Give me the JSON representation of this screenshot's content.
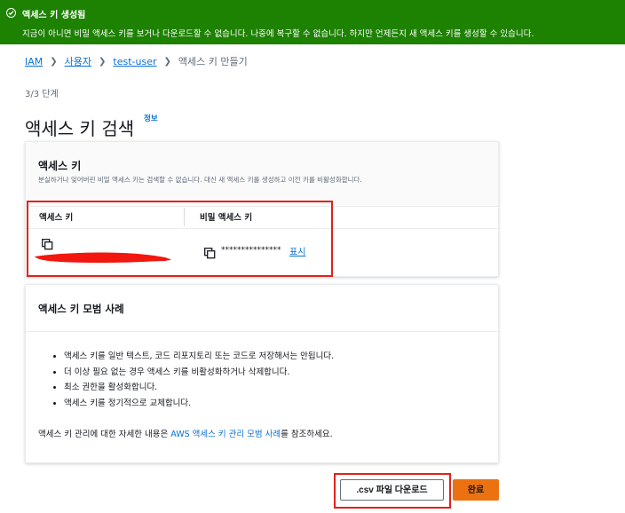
{
  "banner": {
    "title": "액세스 키 생성됨",
    "message": "지금이 아니면 비밀 액세스 키를 보거나 다운로드할 수 없습니다. 나중에 복구할 수 없습니다. 하지만 언제든지 새 액세스 키를 생성할 수 있습니다.",
    "color": "#1d8102"
  },
  "breadcrumb": {
    "items": [
      "IAM",
      "사용자",
      "test-user"
    ],
    "current": "액세스 키 만들기"
  },
  "step": "3/3 단계",
  "page_title": "액세스 키 검색",
  "info_label": "정보",
  "access_key_panel": {
    "title": "액세스 키",
    "description": "분실하거나 잊어버린 비밀 액세스 키는 검색할 수 없습니다. 대신 새 액세스 키를 생성하고 이전 키를 비활성화합니다.",
    "columns": [
      "액세스 키",
      "비밀 액세스 키"
    ],
    "secret_masked": "***************",
    "show_label": "표시"
  },
  "best_practices": {
    "title": "액세스 키 모범 사례",
    "items": [
      "액세스 키를 일반 텍스트, 코드 리포지토리 또는 코드로 저장해서는 안됩니다.",
      "더 이상 필요 없는 경우 액세스 키를 비활성화하거나 삭제합니다.",
      "최소 권한을 활성화합니다.",
      "액세스 키를 정기적으로 교체합니다."
    ],
    "note_prefix": "액세스 키 관리에 대한 자세한 내용은 ",
    "note_link": "AWS 액세스 키 관리 모범 사례",
    "note_suffix": "를 참조하세요."
  },
  "buttons": {
    "download_csv": ".csv 파일 다운로드",
    "done": "완료"
  },
  "colors": {
    "link": "#0972d3",
    "primary_button": "#ec7211",
    "annotation": "#e0221b"
  }
}
